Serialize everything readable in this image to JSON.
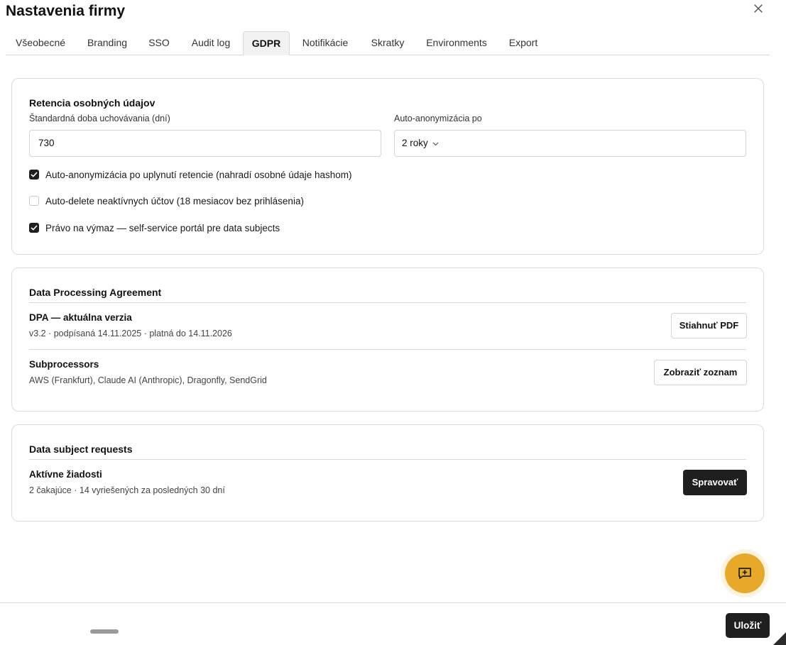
{
  "header": {
    "title": "Nastavenia firmy"
  },
  "tabs": [
    {
      "label": "Všeobecné"
    },
    {
      "label": "Branding"
    },
    {
      "label": "SSO"
    },
    {
      "label": "Audit log"
    },
    {
      "label": "GDPR",
      "active": true
    },
    {
      "label": "Notifikácie"
    },
    {
      "label": "Skratky"
    },
    {
      "label": "Environments"
    },
    {
      "label": "Export"
    }
  ],
  "retention": {
    "title": "Retencia osobných údajov",
    "storage_label": "Štandardná doba uchovávania (dní)",
    "storage_value": "730",
    "anonymize_label": "Auto-anonymizácia po",
    "anonymize_value": "2 roky",
    "checks": [
      {
        "label": "Auto-anonymizácia po uplynutí retencie (nahradí osobné údaje hashom)",
        "checked": true
      },
      {
        "label": "Auto-delete neaktívnych účtov (18 mesiacov bez prihlásenia)",
        "checked": false
      },
      {
        "label": "Právo na výmaz — self-service portál pre data subjects",
        "checked": true
      }
    ]
  },
  "dpa": {
    "title": "Data Processing Agreement",
    "current": {
      "title": "DPA — aktuálna verzia",
      "subtitle": "v3.2 · podpísaná 14.11.2025 · platná do 14.11.2026",
      "button": "Stiahnuť PDF"
    },
    "subprocessors": {
      "title": "Subprocessors",
      "subtitle": "AWS (Frankfurt), Claude AI (Anthropic), Dragonfly, SendGrid",
      "button": "Zobraziť zoznam"
    }
  },
  "dsr": {
    "title": "Data subject requests",
    "active": {
      "title": "Aktívne žiadosti",
      "subtitle": "2 čakajúce · 14 vyriešených za posledných 30 dní",
      "button": "Spravovať"
    }
  },
  "footer": {
    "save_label": "Uložiť"
  },
  "colors": {
    "accent": "#e8a92a",
    "dark": "#1f1f1f"
  },
  "icons": [
    "close-icon",
    "chevron-down-icon",
    "check-icon",
    "feedback-icon"
  ]
}
